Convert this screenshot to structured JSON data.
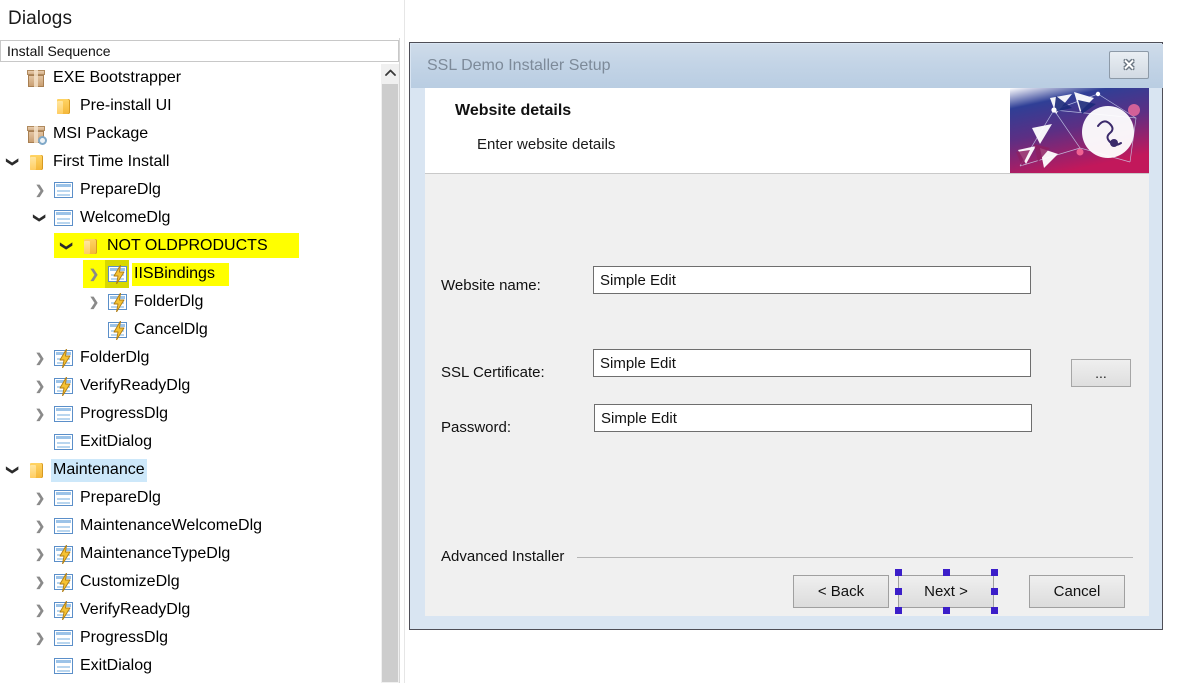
{
  "panel": {
    "title": "Dialogs",
    "combo_value": "Install Sequence",
    "scrollbar": {
      "up_arrow": "scroll-up-arrow"
    }
  },
  "tree": {
    "items": [
      {
        "label": "EXE Bootstrapper",
        "indent": 0,
        "expander": "none",
        "icon": "package-icon",
        "highlight": "none"
      },
      {
        "label": "Pre-install UI",
        "indent": 1,
        "expander": "none",
        "icon": "folder-icon",
        "highlight": "none"
      },
      {
        "label": "MSI Package",
        "indent": 0,
        "expander": "none",
        "icon": "msi-package-icon",
        "highlight": "none"
      },
      {
        "label": "First Time Install",
        "indent": 0,
        "expander": "down",
        "icon": "folder-icon",
        "highlight": "none"
      },
      {
        "label": "PrepareDlg",
        "indent": 1,
        "expander": "right",
        "icon": "dialog-icon",
        "highlight": "none"
      },
      {
        "label": "WelcomeDlg",
        "indent": 1,
        "expander": "down",
        "icon": "dialog-icon",
        "highlight": "none"
      },
      {
        "label": "NOT OLDPRODUCTS",
        "indent": 2,
        "expander": "down",
        "icon": "folder-icon",
        "highlight": "yellow-row"
      },
      {
        "label": "IISBindings",
        "indent": 3,
        "expander": "right",
        "icon": "dialog-event-icon",
        "highlight": "olive-row"
      },
      {
        "label": "FolderDlg",
        "indent": 3,
        "expander": "right",
        "icon": "dialog-event-icon",
        "highlight": "none"
      },
      {
        "label": "CancelDlg",
        "indent": 3,
        "expander": "none",
        "icon": "dialog-event-icon",
        "highlight": "none"
      },
      {
        "label": "FolderDlg",
        "indent": 1,
        "expander": "right",
        "icon": "dialog-event-icon",
        "highlight": "none"
      },
      {
        "label": "VerifyReadyDlg",
        "indent": 1,
        "expander": "right",
        "icon": "dialog-event-icon",
        "highlight": "none"
      },
      {
        "label": "ProgressDlg",
        "indent": 1,
        "expander": "right",
        "icon": "dialog-icon",
        "highlight": "none"
      },
      {
        "label": "ExitDialog",
        "indent": 1,
        "expander": "none",
        "icon": "dialog-icon",
        "highlight": "none"
      },
      {
        "label": "Maintenance",
        "indent": 0,
        "expander": "down",
        "icon": "folder-icon",
        "highlight": "selected"
      },
      {
        "label": "PrepareDlg",
        "indent": 1,
        "expander": "right",
        "icon": "dialog-icon",
        "highlight": "none"
      },
      {
        "label": "MaintenanceWelcomeDlg",
        "indent": 1,
        "expander": "right",
        "icon": "dialog-icon",
        "highlight": "none"
      },
      {
        "label": "MaintenanceTypeDlg",
        "indent": 1,
        "expander": "right",
        "icon": "dialog-event-icon",
        "highlight": "none"
      },
      {
        "label": "CustomizeDlg",
        "indent": 1,
        "expander": "right",
        "icon": "dialog-event-icon",
        "highlight": "none"
      },
      {
        "label": "VerifyReadyDlg",
        "indent": 1,
        "expander": "right",
        "icon": "dialog-event-icon",
        "highlight": "none"
      },
      {
        "label": "ProgressDlg",
        "indent": 1,
        "expander": "right",
        "icon": "dialog-icon",
        "highlight": "none"
      },
      {
        "label": "ExitDialog",
        "indent": 1,
        "expander": "none",
        "icon": "dialog-icon",
        "highlight": "none"
      }
    ]
  },
  "dialog": {
    "window_title": "SSL Demo Installer Setup",
    "close_label": "✕",
    "header": {
      "title": "Website details",
      "subtitle": "Enter website details",
      "banner": "advanced-installer-banner"
    },
    "fields": [
      {
        "label": "Website name:",
        "value": "Simple Edit"
      },
      {
        "label": "SSL Certificate:",
        "value": "Simple Edit"
      },
      {
        "label": "Password:",
        "value": "Simple Edit"
      }
    ],
    "browse_label": "...",
    "footer_label": "Advanced Installer",
    "buttons": {
      "back": "< Back",
      "next": "Next >",
      "cancel": "Cancel"
    }
  },
  "colors": {
    "highlight_yellow": "#ffff00",
    "highlight_olive": "#d8d800",
    "selection_blue": "#cde8fa",
    "handle_blue": "#3b1ec9",
    "titlebar_blue": "#c3d4e6"
  }
}
